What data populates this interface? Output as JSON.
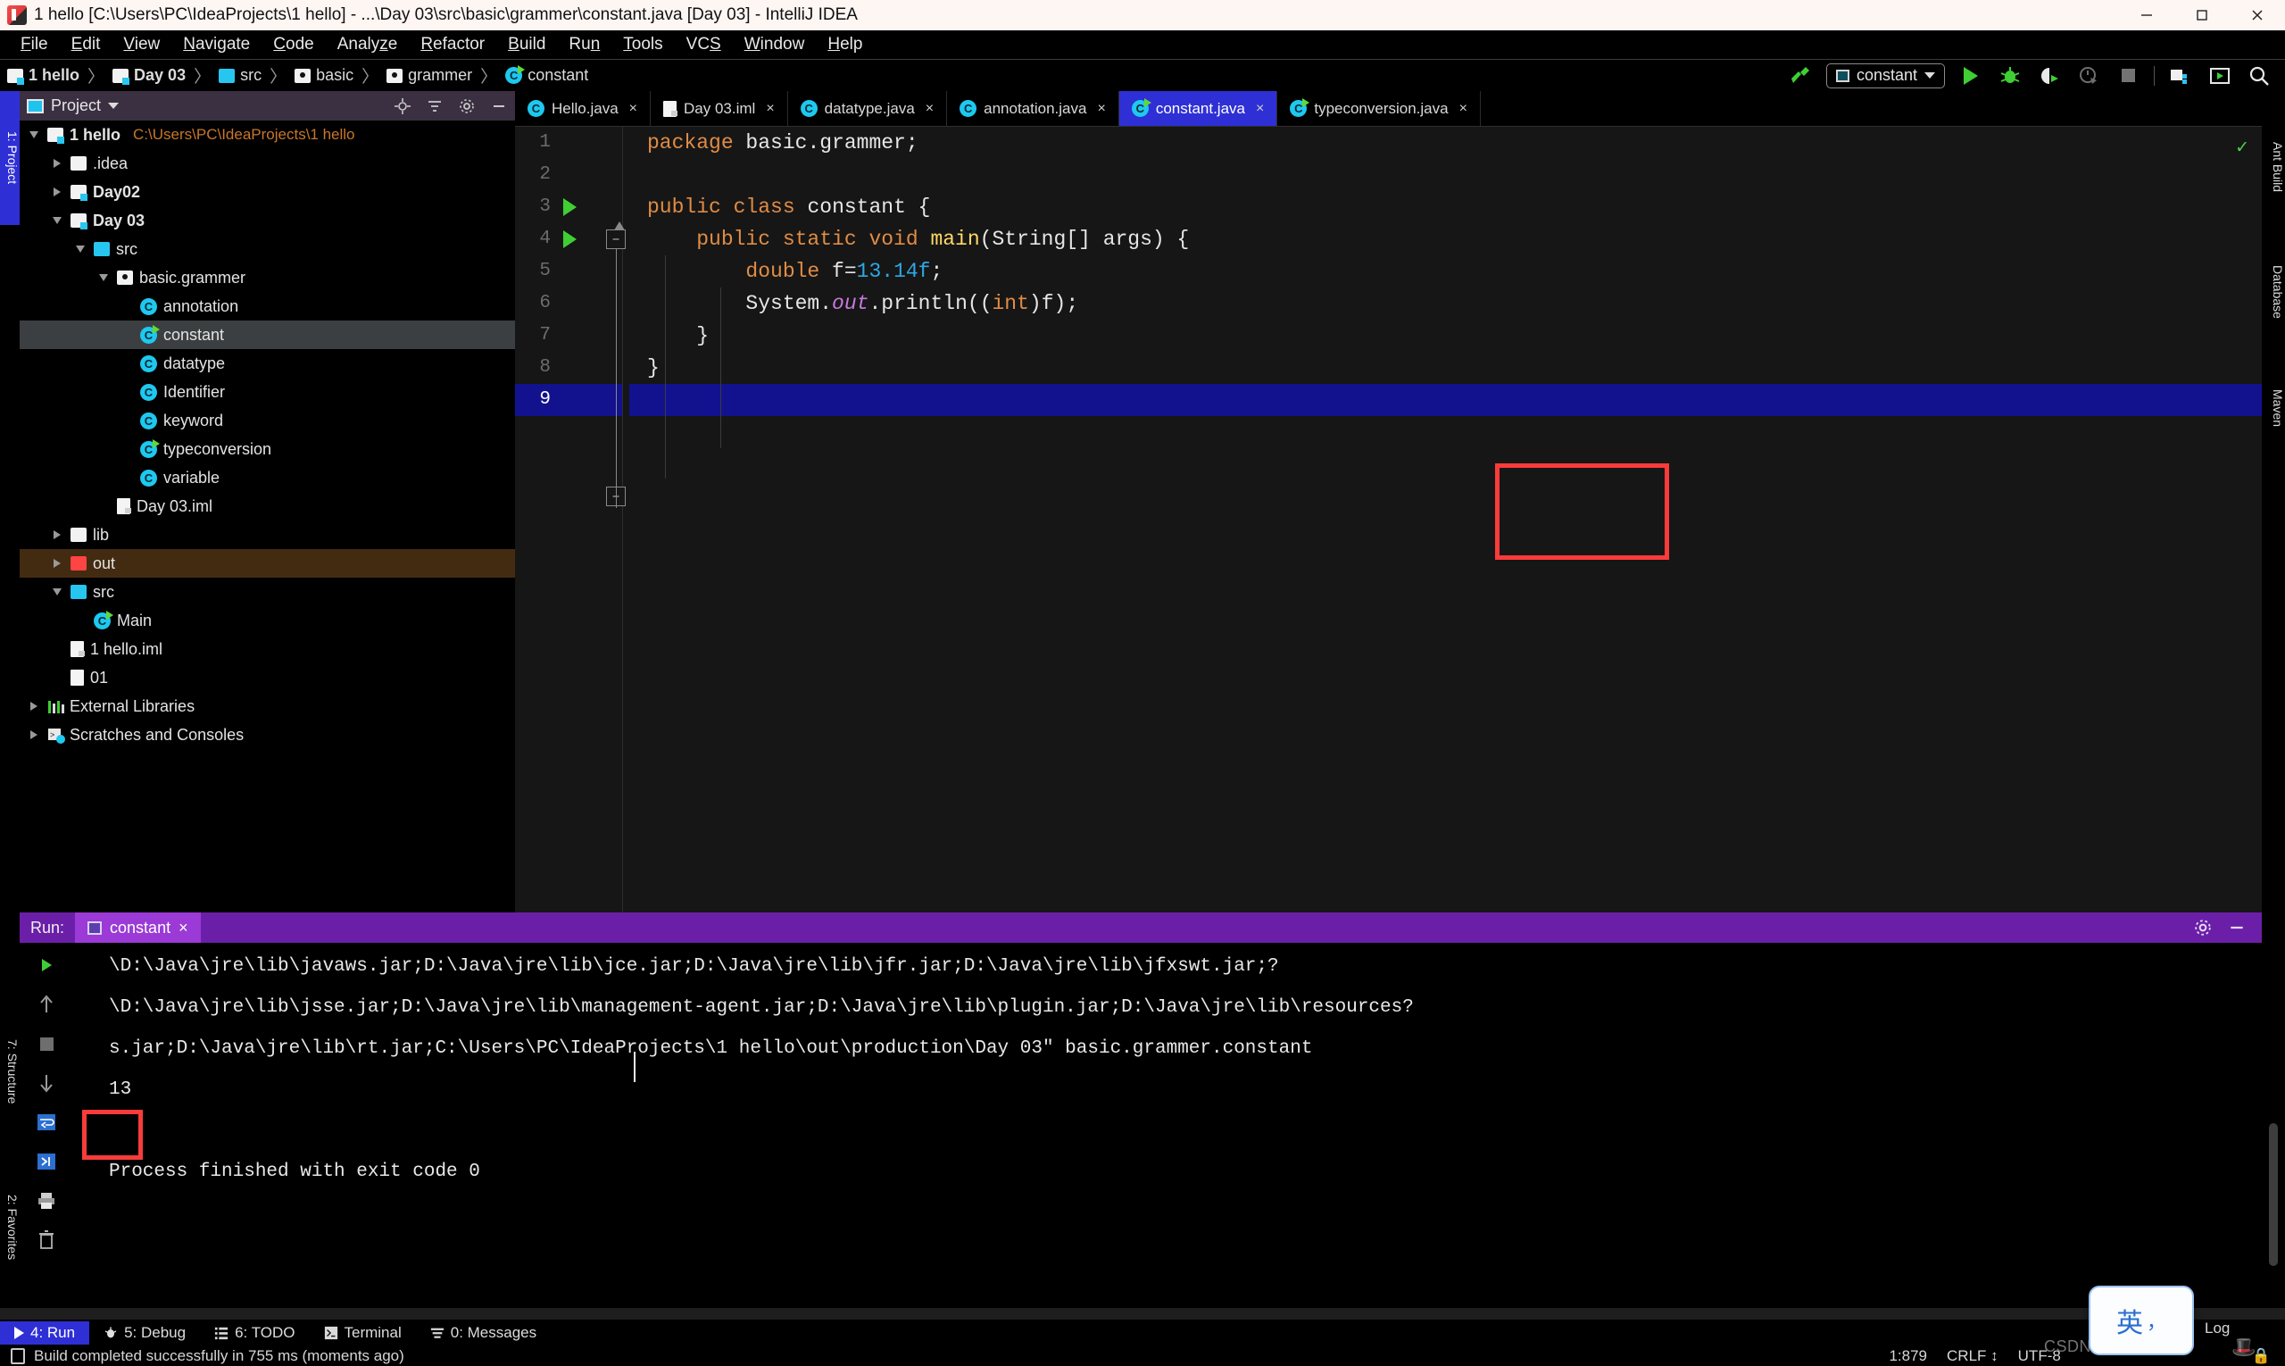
{
  "window": {
    "title": "1 hello [C:\\Users\\PC\\IdeaProjects\\1 hello] - ...\\Day 03\\src\\basic\\grammer\\constant.java [Day 03] - IntelliJ IDEA",
    "app_icon": "intellij-idea-icon",
    "minimize": "minimize-icon",
    "maximize": "maximize-icon",
    "close": "close-icon"
  },
  "menubar": {
    "items": [
      {
        "label": "File",
        "mnemonic": "F"
      },
      {
        "label": "Edit",
        "mnemonic": "E"
      },
      {
        "label": "View",
        "mnemonic": "V"
      },
      {
        "label": "Navigate",
        "mnemonic": "N"
      },
      {
        "label": "Code",
        "mnemonic": "C"
      },
      {
        "label": "Analyze",
        "mnemonic": "z"
      },
      {
        "label": "Refactor",
        "mnemonic": "R"
      },
      {
        "label": "Build",
        "mnemonic": "B"
      },
      {
        "label": "Run",
        "mnemonic": "n"
      },
      {
        "label": "Tools",
        "mnemonic": "T"
      },
      {
        "label": "VCS",
        "mnemonic": "S"
      },
      {
        "label": "Window",
        "mnemonic": "W"
      },
      {
        "label": "Help",
        "mnemonic": "H"
      }
    ]
  },
  "breadcrumb": {
    "items": [
      {
        "label": "1 hello",
        "icon": "module-folder-icon",
        "bold": true
      },
      {
        "label": "Day 03",
        "icon": "module-folder-icon",
        "bold": true
      },
      {
        "label": "src",
        "icon": "source-folder-icon",
        "bold": false
      },
      {
        "label": "basic",
        "icon": "package-folder-icon",
        "bold": false
      },
      {
        "label": "grammer",
        "icon": "package-folder-icon",
        "bold": false
      },
      {
        "label": "constant",
        "icon": "java-class-icon",
        "bold": false
      }
    ],
    "separator": "〉"
  },
  "toolbar": {
    "hammer_icon": "build-hammer-icon",
    "run_config": "constant",
    "run_config_icon": "run-configuration-icon",
    "dropdown_icon": "chevron-down-icon",
    "run_icon": "run-icon",
    "debug_icon": "debug-icon",
    "run_with_coverage_icon": "run-coverage-icon",
    "profile_icon": "profiler-icon",
    "stop_icon": "stop-icon",
    "project_structure_icon": "project-structure-icon",
    "update_icon": "update-project-icon",
    "search_icon": "search-everywhere-icon"
  },
  "left_tool_strip": {
    "tabs": [
      {
        "label": "1: Project",
        "active": true,
        "icon": "project-icon"
      }
    ],
    "bottom_tabs": [
      {
        "label": "7: Structure",
        "icon": "structure-icon"
      },
      {
        "label": "2: Favorites",
        "icon": "favorites-icon"
      }
    ]
  },
  "right_tool_strip": {
    "tabs": [
      {
        "label": "Ant Build",
        "icon": "ant-icon"
      },
      {
        "label": "Database",
        "icon": "database-icon"
      },
      {
        "label": "Maven",
        "icon": "maven-icon"
      }
    ]
  },
  "project_panel": {
    "title": "Project",
    "title_icon": "project-view-icon",
    "dropdown_icon": "chevron-down-icon",
    "actions": [
      "locate-icon",
      "collapse-all-icon",
      "settings-gear-icon",
      "hide-icon"
    ],
    "tree": [
      {
        "label": "1 hello",
        "path": "C:\\Users\\PC\\IdeaProjects\\1 hello",
        "depth": 0,
        "icon": "module-folder-icon",
        "arrow": "down",
        "bold": true,
        "state": "none"
      },
      {
        "label": ".idea",
        "path": "",
        "depth": 1,
        "icon": "plain-folder-icon",
        "arrow": "right",
        "bold": false,
        "state": "none"
      },
      {
        "label": "Day02",
        "path": "",
        "depth": 1,
        "icon": "module-folder-icon",
        "arrow": "right",
        "bold": true,
        "state": "none"
      },
      {
        "label": "Day 03",
        "path": "",
        "depth": 1,
        "icon": "module-folder-icon",
        "arrow": "down",
        "bold": true,
        "state": "none"
      },
      {
        "label": "src",
        "path": "",
        "depth": 2,
        "icon": "source-folder-icon",
        "arrow": "down",
        "bold": false,
        "state": "none"
      },
      {
        "label": "basic.grammer",
        "path": "",
        "depth": 3,
        "icon": "package-folder-icon",
        "arrow": "down",
        "bold": false,
        "state": "none"
      },
      {
        "label": "annotation",
        "path": "",
        "depth": 4,
        "icon": "java-class-icon",
        "arrow": "none",
        "bold": false,
        "state": "none"
      },
      {
        "label": "constant",
        "path": "",
        "depth": 4,
        "icon": "java-class-runnable-icon",
        "arrow": "none",
        "bold": false,
        "state": "selected"
      },
      {
        "label": "datatype",
        "path": "",
        "depth": 4,
        "icon": "java-class-icon",
        "arrow": "none",
        "bold": false,
        "state": "none"
      },
      {
        "label": "Identifier",
        "path": "",
        "depth": 4,
        "icon": "java-class-icon",
        "arrow": "none",
        "bold": false,
        "state": "none"
      },
      {
        "label": "keyword",
        "path": "",
        "depth": 4,
        "icon": "java-class-icon",
        "arrow": "none",
        "bold": false,
        "state": "none"
      },
      {
        "label": "typeconversion",
        "path": "",
        "depth": 4,
        "icon": "java-class-runnable-icon",
        "arrow": "none",
        "bold": false,
        "state": "none"
      },
      {
        "label": "variable",
        "path": "",
        "depth": 4,
        "icon": "java-class-icon",
        "arrow": "none",
        "bold": false,
        "state": "none"
      },
      {
        "label": "Day 03.iml",
        "path": "",
        "depth": 3,
        "icon": "iml-file-icon",
        "arrow": "none",
        "bold": false,
        "state": "none"
      },
      {
        "label": "lib",
        "path": "",
        "depth": 1,
        "icon": "plain-folder-icon",
        "arrow": "right",
        "bold": false,
        "state": "none"
      },
      {
        "label": "out",
        "path": "",
        "depth": 1,
        "icon": "excluded-folder-icon",
        "arrow": "right",
        "bold": false,
        "state": "highlighted"
      },
      {
        "label": "src",
        "path": "",
        "depth": 1,
        "icon": "source-folder-icon",
        "arrow": "down",
        "bold": false,
        "state": "none"
      },
      {
        "label": "Main",
        "path": "",
        "depth": 2,
        "icon": "java-class-runnable-icon",
        "arrow": "none",
        "bold": false,
        "state": "none"
      },
      {
        "label": "1 hello.iml",
        "path": "",
        "depth": 1,
        "icon": "iml-file-icon",
        "arrow": "none",
        "bold": false,
        "state": "none"
      },
      {
        "label": "01",
        "path": "",
        "depth": 1,
        "icon": "text-file-icon",
        "arrow": "none",
        "bold": false,
        "state": "none"
      },
      {
        "label": "External Libraries",
        "path": "",
        "depth": 0,
        "icon": "libraries-icon",
        "arrow": "right",
        "bold": false,
        "state": "none"
      },
      {
        "label": "Scratches and Consoles",
        "path": "",
        "depth": 0,
        "icon": "scratches-icon",
        "arrow": "right",
        "bold": false,
        "state": "none"
      }
    ]
  },
  "editor": {
    "tabs": [
      {
        "label": "Hello.java",
        "icon": "java-class-icon",
        "active": false,
        "close": "×"
      },
      {
        "label": "Day 03.iml",
        "icon": "iml-file-icon",
        "active": false,
        "close": "×"
      },
      {
        "label": "datatype.java",
        "icon": "java-class-icon",
        "active": false,
        "close": "×"
      },
      {
        "label": "annotation.java",
        "icon": "java-class-icon",
        "active": false,
        "close": "×"
      },
      {
        "label": "constant.java",
        "icon": "java-class-runnable-icon",
        "active": true,
        "close": "×"
      },
      {
        "label": "typeconversion.java",
        "icon": "java-class-runnable-icon",
        "active": false,
        "close": "×"
      }
    ],
    "inspection_status": "✓",
    "lines": [
      {
        "n": "1",
        "gutter_run": false,
        "selected": false
      },
      {
        "n": "2",
        "gutter_run": false,
        "selected": false
      },
      {
        "n": "3",
        "gutter_run": true,
        "selected": false
      },
      {
        "n": "4",
        "gutter_run": true,
        "selected": false
      },
      {
        "n": "5",
        "gutter_run": false,
        "selected": false
      },
      {
        "n": "6",
        "gutter_run": false,
        "selected": false
      },
      {
        "n": "7",
        "gutter_run": false,
        "selected": false
      },
      {
        "n": "8",
        "gutter_run": false,
        "selected": false
      },
      {
        "n": "9",
        "gutter_run": false,
        "selected": true
      }
    ],
    "code": {
      "l1_kw": "package",
      "l1_rest": " basic.grammer;",
      "l3_kw1": "public",
      "l3_kw2": " class",
      "l3_rest": " constant {",
      "l4_kw": "    public static void ",
      "l4_mth": "main",
      "l4_rest": "(String[] args) {",
      "l5_kw": "        double",
      "l5_var": " f=",
      "l5_num": "13.14f",
      "l5_end": ";",
      "l6_a": "        System.",
      "l6_fld": "out",
      "l6_b": ".println((",
      "l6_cast": "int",
      "l6_c": ")f);",
      "l7": "    }",
      "l8": "}"
    },
    "annotation_box_label": "red-highlight-box-cast-expression"
  },
  "run_panel": {
    "label": "Run:",
    "tab": "constant",
    "tab_icon": "run-configuration-icon",
    "close_icon": "×",
    "settings_icon": "settings-gear-icon",
    "hide_icon": "hide-icon",
    "side_actions": [
      "rerun-icon",
      "stop-icon",
      "scroll-up-icon",
      "scroll-down-icon",
      "soft-wrap-icon",
      "scroll-to-end-icon",
      "print-icon",
      "clear-all-icon"
    ],
    "console_lines": [
      "\\D:\\Java\\jre\\lib\\javaws.jar;D:\\Java\\jre\\lib\\jce.jar;D:\\Java\\jre\\lib\\jfr.jar;D:\\Java\\jre\\lib\\jfxswt.jar;?",
      "\\D:\\Java\\jre\\lib\\jsse.jar;D:\\Java\\jre\\lib\\management-agent.jar;D:\\Java\\jre\\lib\\plugin.jar;D:\\Java\\jre\\lib\\resources?",
      "s.jar;D:\\Java\\jre\\lib\\rt.jar;C:\\Users\\PC\\IdeaProjects\\1 hello\\out\\production\\Day 03\" basic.grammer.constant",
      "13",
      "",
      "Process finished with exit code 0"
    ],
    "output_value": "13",
    "output_box_label": "red-highlight-box-output"
  },
  "bottom_bar": {
    "items": [
      {
        "label": "4: Run",
        "icon": "run-icon",
        "active": true
      },
      {
        "label": "5: Debug",
        "icon": "debug-icon",
        "active": false
      },
      {
        "label": "6: TODO",
        "icon": "todo-icon",
        "active": false
      },
      {
        "label": "Terminal",
        "icon": "terminal-icon",
        "active": false
      },
      {
        "label": "0: Messages",
        "icon": "messages-icon",
        "active": false
      }
    ]
  },
  "status_bar": {
    "icon": "event-log-icon",
    "message": "Build completed successfully in 755 ms (moments ago)",
    "caret_position": "1:879",
    "line_separator": "CRLF",
    "encoding": "UTF-8",
    "event_log": "Log",
    "lock_icon": "lock-icon",
    "ime_indicator": "英",
    "ime_secondary": "，",
    "watermark": "CSDN @devlist_",
    "hat_icon": "hat-icon"
  },
  "colors": {
    "accent_blue": "#2f2fd6",
    "run_purple": "#6b1fa8",
    "run_tab_purple": "#9b3ad6",
    "annotation_red": "#fb3b3b",
    "keyword_orange": "#e08c45",
    "number_blue": "#2ea8e6",
    "method_yellow": "#ffd866",
    "field_purple": "#c679dd",
    "green_run": "#3fcf34",
    "excluded_red": "#ff4444"
  }
}
